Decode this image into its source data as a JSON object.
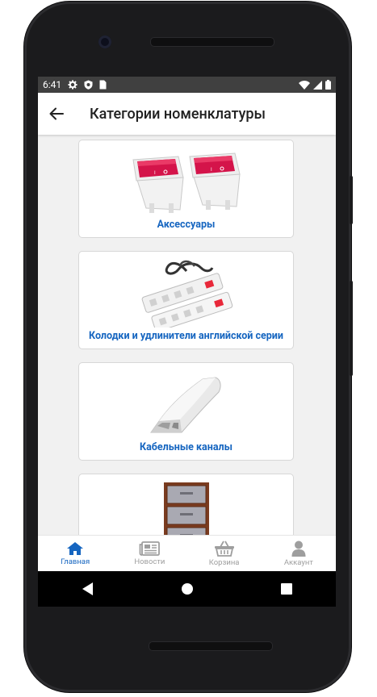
{
  "status_bar": {
    "time": "6:41",
    "left_icons": [
      "settings-icon",
      "shield-icon",
      "sim-card-icon"
    ],
    "right_icons": [
      "wifi-icon",
      "signal-icon",
      "battery-icon"
    ]
  },
  "app_bar": {
    "back_icon": "arrow-left-icon",
    "title": "Категории номенклатуры"
  },
  "categories": [
    {
      "label": "Аксессуары",
      "image": "rocker-switches"
    },
    {
      "label": "Колодки и удлинители английской серии",
      "image": "power-strips"
    },
    {
      "label": "Кабельные каналы",
      "image": "cable-channel"
    },
    {
      "label": "",
      "image": "cabinet"
    }
  ],
  "bottom_nav": [
    {
      "label": "Главная",
      "icon": "home-icon",
      "active": true
    },
    {
      "label": "Новости",
      "icon": "newspaper-icon",
      "active": false
    },
    {
      "label": "Корзина",
      "icon": "basket-icon",
      "active": false
    },
    {
      "label": "Аккаунт",
      "icon": "user-icon",
      "active": false
    }
  ],
  "colors": {
    "accent": "#1565c0",
    "inactive": "#9e9e9e",
    "status_bar": "#404040",
    "background": "#f1f1f1"
  }
}
